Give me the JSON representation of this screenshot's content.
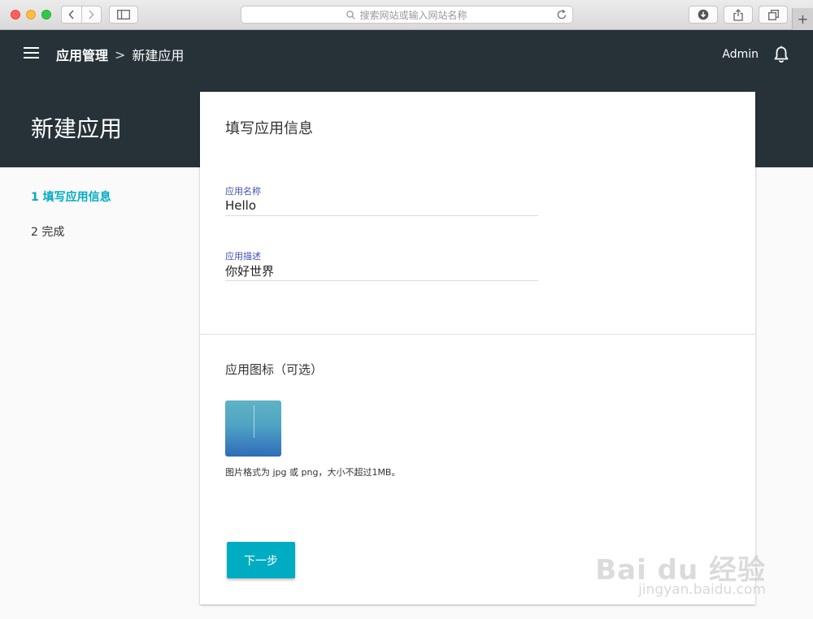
{
  "browser": {
    "address_placeholder": "搜索网站或输入网站名称",
    "new_tab_symbol": "+"
  },
  "header": {
    "breadcrumb_root": "应用管理",
    "breadcrumb_separator": ">",
    "breadcrumb_current": "新建应用",
    "user": "Admin",
    "page_title": "新建应用"
  },
  "steps": [
    {
      "label": "1 填写应用信息",
      "state": "active"
    },
    {
      "label": "2 完成",
      "state": "todo"
    }
  ],
  "form": {
    "title": "填写应用信息",
    "name_label": "应用名称",
    "name_value": "Hello",
    "desc_label": "应用描述",
    "desc_value": "你好世界",
    "icon_section_title": "应用图标（可选）",
    "icon_hint": "图片格式为 jpg 或 png，大小不超过1MB。",
    "next_button": "下一步"
  },
  "watermark": {
    "brand": "Bai du 经验",
    "url": "jingyan.baidu.com"
  },
  "colors": {
    "header_bg": "#263238",
    "accent": "#00acc1",
    "field_label": "#3f51b5"
  }
}
